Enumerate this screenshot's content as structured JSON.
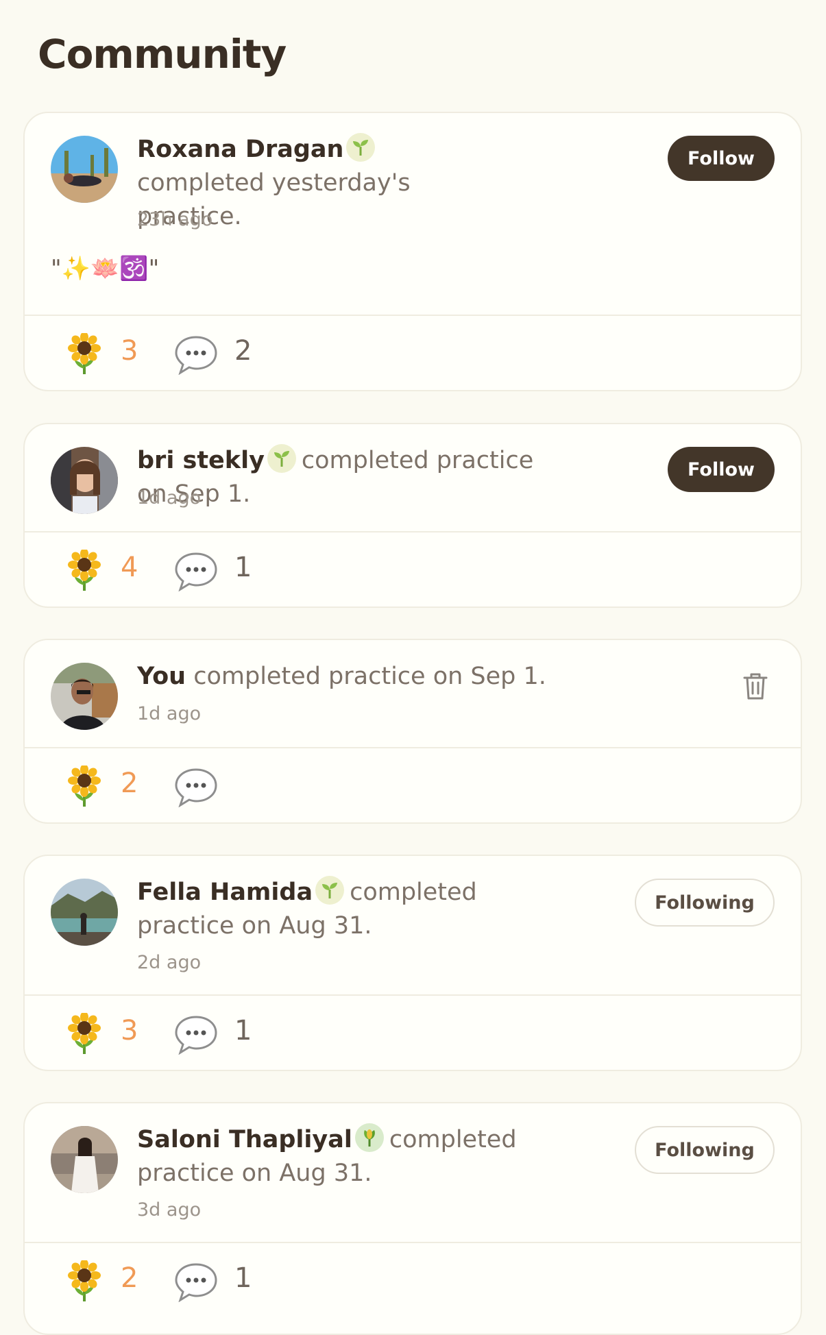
{
  "page": {
    "title": "Community"
  },
  "posts": [
    {
      "author": "Roxana Dragan",
      "action": "completed yesterday's practice.",
      "time": "23h ago",
      "button": "Follow",
      "body": "\"✨🪷🕉️\"",
      "likes": "3",
      "comments": "2"
    },
    {
      "author": "bri stekly",
      "action": "completed practice on Sep 1.",
      "time": "1d ago",
      "button": "Follow",
      "likes": "4",
      "comments": "1"
    },
    {
      "author": "You",
      "action": "completed practice on Sep 1.",
      "time": "1d ago",
      "likes": "2",
      "comments": ""
    },
    {
      "author": "Fella Hamida",
      "action": "completed practice on Aug 31.",
      "time": "2d ago",
      "button": "Following",
      "likes": "3",
      "comments": "1"
    },
    {
      "author": "Saloni Thapliyal",
      "action": "completed practice on Aug 31.",
      "time": "3d ago",
      "button": "Following",
      "likes": "2",
      "comments": "1"
    }
  ],
  "icons": {
    "like": "sunflower-icon",
    "comment": "speech-bubble-icon",
    "delete": "trash-icon",
    "badge": "sprout-icon"
  },
  "colors": {
    "background": "#FBFAF2",
    "follow_button": "#433629",
    "like_count": "#F09A55"
  }
}
